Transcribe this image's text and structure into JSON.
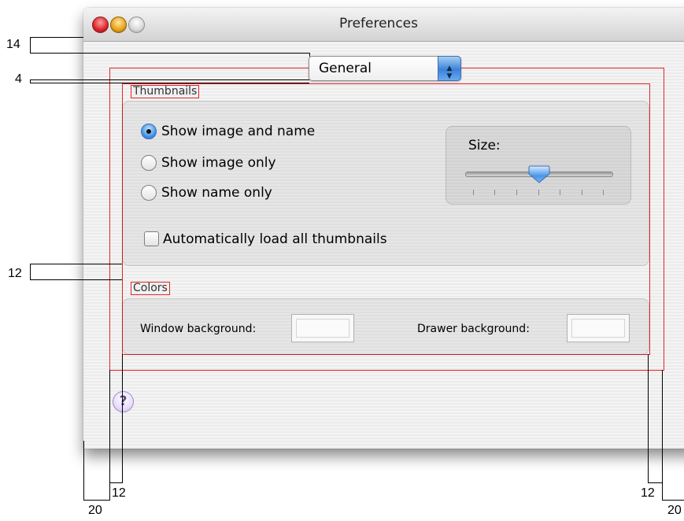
{
  "window": {
    "title": "Preferences",
    "controls": [
      "close-button",
      "minimize-button",
      "zoom-button"
    ]
  },
  "popup": {
    "selected": "General"
  },
  "thumbnails": {
    "title": "Thumbnails",
    "options": [
      {
        "label": "Show image and name",
        "selected": true
      },
      {
        "label": "Show image only",
        "selected": false
      },
      {
        "label": "Show name only",
        "selected": false
      }
    ],
    "auto_load_label": "Automatically load all thumbnails",
    "auto_load_checked": false,
    "size": {
      "label": "Size:",
      "value_fraction": 0.5,
      "tick_count": 7
    }
  },
  "colors": {
    "title": "Colors",
    "window_background_label": "Window background:",
    "drawer_background_label": "Drawer background:"
  },
  "help_label": "?",
  "annotations": {
    "a14": "14",
    "a4": "4",
    "a12_left": "12",
    "a12_bottom_left": "12",
    "a12_bottom_right": "12",
    "a20_left": "20",
    "a20_right": "20"
  },
  "colors_accent": {
    "guide": "#e6232a",
    "select": "#3b82d9"
  }
}
